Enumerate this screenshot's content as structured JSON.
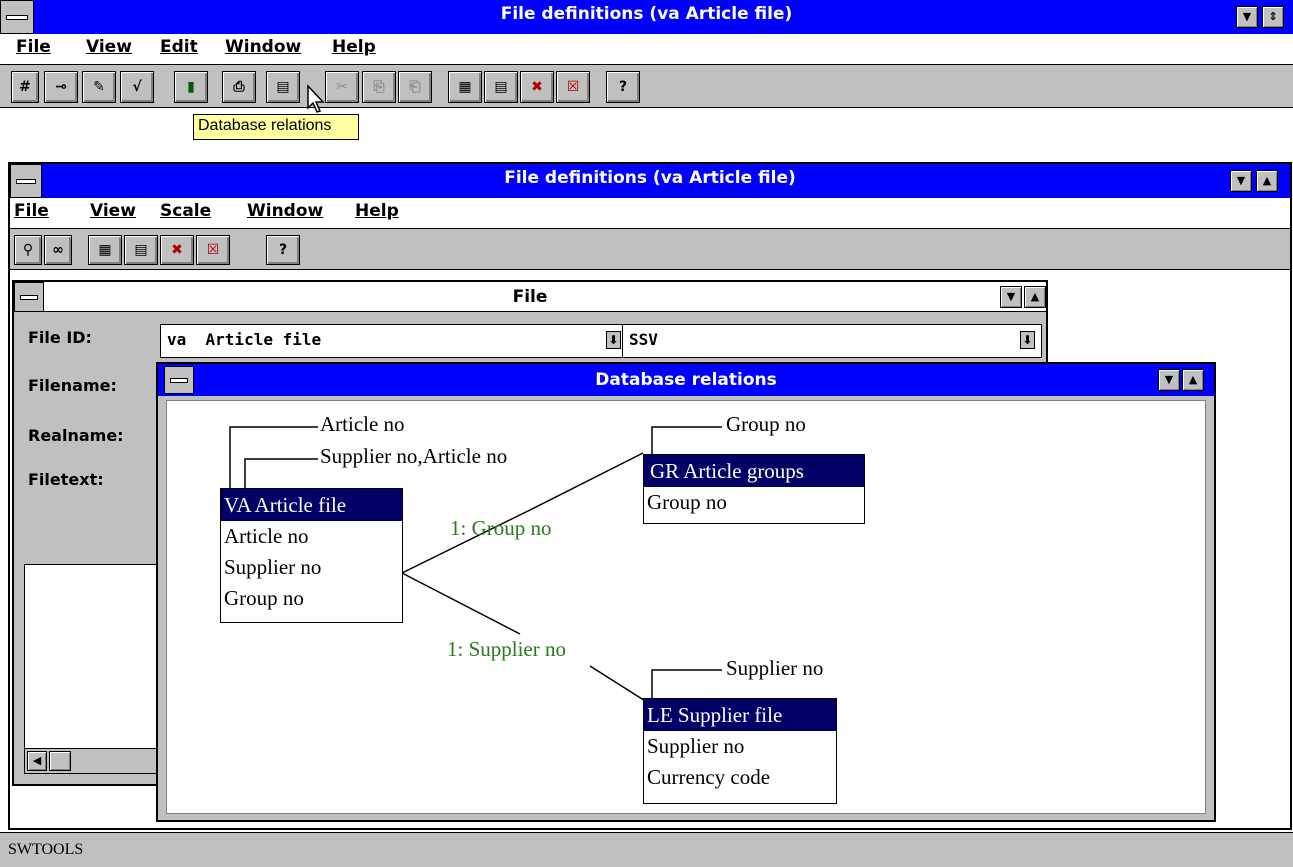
{
  "outer": {
    "title": "File definitions (va Article file)",
    "menu": [
      "File",
      "View",
      "Edit",
      "Window",
      "Help"
    ],
    "toolbar_glyphs": [
      "#",
      "⊸",
      "✎",
      "√",
      "▮",
      "⎙",
      "▤",
      "✂",
      "⎘",
      "⎗",
      "▦",
      "▤",
      "✖",
      "☒",
      "?"
    ],
    "tooltip": "Database relations"
  },
  "inner": {
    "title": "File definitions (va Article file)",
    "menu": [
      "File",
      "View",
      "Scale",
      "Window",
      "Help"
    ],
    "toolbar_glyphs": [
      "⚲",
      "∞",
      "▦",
      "▤",
      "✖",
      "☒",
      "?"
    ]
  },
  "file_window": {
    "title": "File",
    "labels": [
      "File ID:",
      "Filename:",
      "Realname:",
      "Filetext:"
    ],
    "file_id_value": "va  Article file",
    "ssv_value": "SSV"
  },
  "relations_window": {
    "title": "Database relations",
    "va_keys": [
      "Article no",
      "Supplier no,Article no"
    ],
    "va_box": {
      "header": "VA Article file",
      "rows": [
        "Article no",
        "Supplier no",
        "Group no"
      ]
    },
    "gr_key": "Group no",
    "gr_box": {
      "header": "GR Article groups",
      "rows": [
        "Group no"
      ]
    },
    "le_key": "Supplier no",
    "le_box": {
      "header": "LE Supplier file",
      "rows": [
        "Supplier no",
        "Currency code"
      ]
    },
    "rel_group": "1: Group no",
    "rel_supplier": "1: Supplier no",
    "relation_color": "#2a7a1c",
    "header_color": "#000066"
  },
  "status": {
    "text": "SWTOOLS"
  },
  "colors": {
    "title": "#0000ff",
    "face": "#c0c0c0"
  }
}
